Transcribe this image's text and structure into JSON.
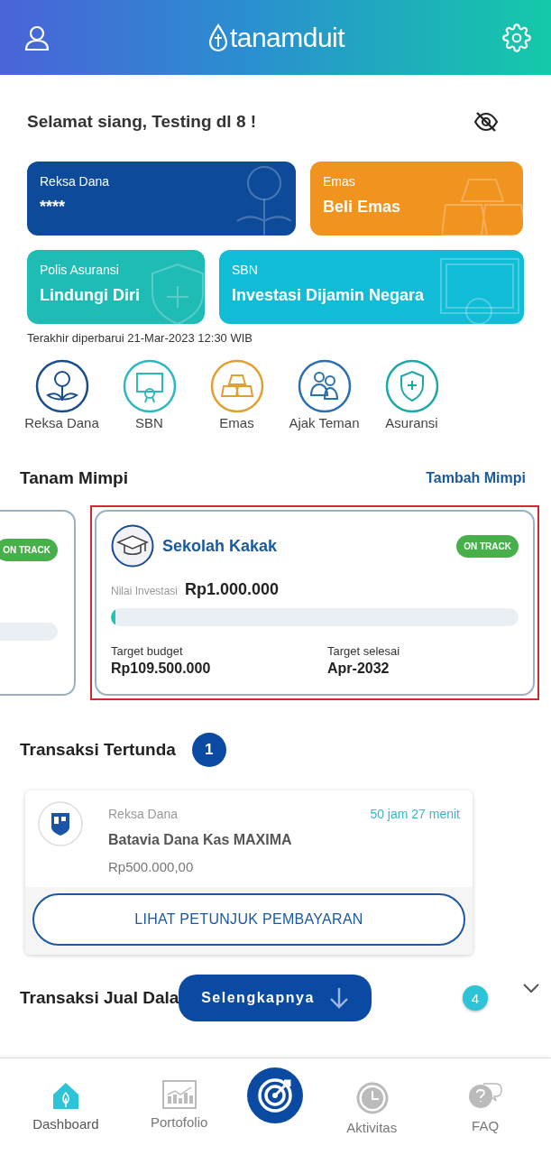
{
  "header": {
    "logo": "tanamduit"
  },
  "greeting": "Selamat siang, Testing dl 8 !",
  "balance_cards": [
    {
      "kind": "reksa",
      "label": "Reksa Dana",
      "value": "****"
    },
    {
      "kind": "emas",
      "label": "Emas",
      "value": "Beli Emas"
    },
    {
      "kind": "asuransi",
      "label": "Polis Asuransi",
      "value": "Lindungi Diri"
    },
    {
      "kind": "sbn",
      "label": "SBN",
      "value": "Investasi Dijamin Negara"
    }
  ],
  "updated": "Terakhir diperbarui 21-Mar-2023 12:30 WIB",
  "shortcuts": [
    {
      "kind": "reksa",
      "label": "Reksa Dana"
    },
    {
      "kind": "sbn",
      "label": "SBN"
    },
    {
      "kind": "emas",
      "label": "Emas"
    },
    {
      "kind": "ajak",
      "label": "Ajak Teman"
    },
    {
      "kind": "asuransi",
      "label": "Asuransi"
    }
  ],
  "dreams_section": {
    "title": "Tanam Mimpi",
    "action": "Tambah Mimpi"
  },
  "previous_dream": {
    "status": "ON TRACK"
  },
  "dream": {
    "name": "Sekolah Kakak",
    "status": "ON TRACK",
    "value_label": "Nilai Investasi",
    "value": "Rp1.000.000",
    "level": 0.01,
    "budget_label": "Target budget",
    "budget": "Rp109.500.000",
    "finish_label": "Target selesai",
    "finish": "Apr-2032",
    "highlighted": true
  },
  "pending": {
    "title": "Transaksi Tertunda",
    "count": "1",
    "item": {
      "category": "Reksa Dana",
      "timer": "50 jam 27 menit",
      "name": "Batavia Dana Kas MAXIMA",
      "amount": "Rp500.000,00",
      "button": "LIHAT PETUNJUK PEMBAYARAN"
    }
  },
  "sell": {
    "title": "Transaksi Jual Dala",
    "count": "4"
  },
  "more_button": "Selengkapnya",
  "bottom_nav": [
    {
      "kind": "home",
      "label": "Dashboard",
      "selected": true
    },
    {
      "kind": "portfolio",
      "label": "Portofolio",
      "selected": false
    },
    {
      "kind": "center",
      "selected": false
    },
    {
      "kind": "activity",
      "label": "Aktivitas",
      "selected": false
    },
    {
      "kind": "faq",
      "label": "FAQ",
      "selected": false
    }
  ]
}
